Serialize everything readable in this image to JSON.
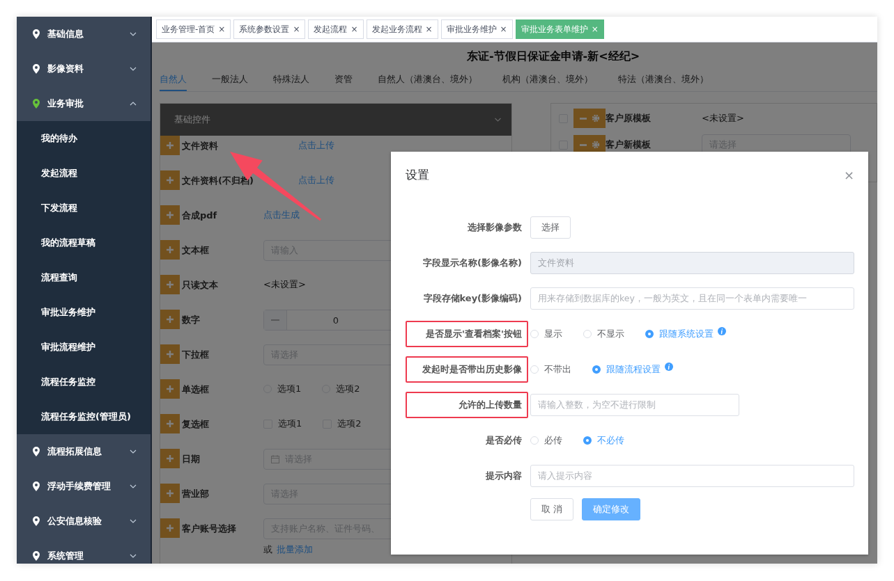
{
  "sidebar": {
    "items": [
      {
        "label": "基础信息",
        "expanded": false
      },
      {
        "label": "影像资料",
        "expanded": false
      },
      {
        "label": "业务审批",
        "expanded": true,
        "children": [
          {
            "label": "我的待办"
          },
          {
            "label": "发起流程"
          },
          {
            "label": "下发流程"
          },
          {
            "label": "我的流程草稿"
          },
          {
            "label": "流程查询"
          },
          {
            "label": "审批业务维护"
          },
          {
            "label": "审批流程维护"
          },
          {
            "label": "流程任务监控"
          },
          {
            "label": "流程任务监控(管理员)"
          }
        ]
      },
      {
        "label": "流程拓展信息",
        "expanded": false
      },
      {
        "label": "浮动手续费管理",
        "expanded": false
      },
      {
        "label": "公安信息核验",
        "expanded": false
      },
      {
        "label": "系统管理",
        "expanded": false
      }
    ]
  },
  "tabs": [
    {
      "label": "业务管理-首页",
      "close": "×",
      "selected": false
    },
    {
      "label": "系统参数设置",
      "close": "×",
      "selected": false
    },
    {
      "label": "发起流程",
      "close": "×",
      "selected": false
    },
    {
      "label": "发起业务流程",
      "close": "×",
      "selected": false
    },
    {
      "label": "审批业务维护",
      "close": "×",
      "selected": false
    },
    {
      "label": "审批业务表单维护",
      "close": "×",
      "selected": true
    }
  ],
  "page_title": "东证-节假日保证金申请-新<经纪>",
  "sub_tabs": [
    {
      "label": "自然人",
      "selected": true
    },
    {
      "label": "一般法人",
      "selected": false
    },
    {
      "label": "特殊法人",
      "selected": false
    },
    {
      "label": "资管",
      "selected": false
    },
    {
      "label": "自然人（港澳台、境外）",
      "selected": false
    },
    {
      "label": "机构（港澳台、境外）",
      "selected": false
    },
    {
      "label": "特法（港澳台、境外）",
      "selected": false
    }
  ],
  "controls_panel": {
    "title": "基础控件",
    "rows": [
      {
        "kind": "upload",
        "label": "文件资料",
        "text": "点击上传"
      },
      {
        "kind": "upload",
        "label": "文件资料(不归档)",
        "text": "点击上传"
      },
      {
        "kind": "link",
        "label": "合成pdf",
        "text": "点击生成"
      },
      {
        "kind": "input",
        "label": "文本框",
        "placeholder": "请输入"
      },
      {
        "kind": "text",
        "label": "只读文本",
        "text": "<未设置>"
      },
      {
        "kind": "number",
        "label": "数字",
        "value": "0"
      },
      {
        "kind": "select",
        "label": "下拉框",
        "placeholder": "请选择"
      },
      {
        "kind": "radio",
        "label": "单选框",
        "options": [
          {
            "label": "选项1",
            "selected": false
          },
          {
            "label": "选项2",
            "selected": false
          }
        ]
      },
      {
        "kind": "checkbox",
        "label": "复选框",
        "options": [
          {
            "label": "选项1",
            "checked": false
          },
          {
            "label": "选项2",
            "checked": false
          }
        ]
      },
      {
        "kind": "date",
        "label": "日期",
        "placeholder": "请选择"
      },
      {
        "kind": "select",
        "label": "营业部",
        "placeholder": "请选择"
      },
      {
        "kind": "account",
        "label": "客户账号选择",
        "placeholder": "支持账户名称、证件号码、",
        "or": "或",
        "link": "批量添加"
      }
    ]
  },
  "form_panel": {
    "rows": [
      {
        "kind": "text",
        "label": "客户原模板",
        "checked": false,
        "text": "<未设置>"
      },
      {
        "kind": "select",
        "label": "客户新模板",
        "checked": false,
        "placeholder": "请选择"
      }
    ]
  },
  "dialog": {
    "title": "设置",
    "close": "×",
    "fields": [
      {
        "kind": "button",
        "label": "选择影像参数",
        "highlighted": false,
        "text": "选择"
      },
      {
        "kind": "input",
        "label": "字段显示名称(影像名称)",
        "highlighted": false,
        "value": "文件资料",
        "disabled": true,
        "wide": true
      },
      {
        "kind": "input",
        "label": "字段存储key(影像编码)",
        "highlighted": false,
        "placeholder": "用来存储到数据库的key，一般为英文，且在同一个表单内需要唯一",
        "disabled": false,
        "wide": true
      },
      {
        "kind": "radio",
        "label": "是否显示'查看档案'按钮",
        "highlighted": true,
        "options": [
          {
            "label": "显示",
            "selected": false,
            "info": false
          },
          {
            "label": "不显示",
            "selected": false,
            "info": false
          },
          {
            "label": "跟随系统设置",
            "selected": true,
            "info": true
          }
        ]
      },
      {
        "kind": "radio",
        "label": "发起时是否带出历史影像",
        "highlighted": true,
        "options": [
          {
            "label": "不带出",
            "selected": false,
            "info": false
          },
          {
            "label": "跟随流程设置",
            "selected": true,
            "info": true
          }
        ]
      },
      {
        "kind": "input",
        "label": "允许的上传数量",
        "highlighted": true,
        "placeholder": "请输入整数，为空不进行限制",
        "disabled": false,
        "wide": false
      },
      {
        "kind": "radio",
        "label": "是否必传",
        "highlighted": false,
        "options": [
          {
            "label": "必传",
            "selected": false,
            "info": false
          },
          {
            "label": "不必传",
            "selected": true,
            "info": false
          }
        ]
      },
      {
        "kind": "input",
        "label": "提示内容",
        "highlighted": false,
        "placeholder": "请入提示内容",
        "disabled": false,
        "wide": true
      }
    ],
    "buttons": [
      {
        "label": "取 消",
        "kind": "default"
      },
      {
        "label": "确定修改",
        "kind": "primary"
      }
    ]
  }
}
